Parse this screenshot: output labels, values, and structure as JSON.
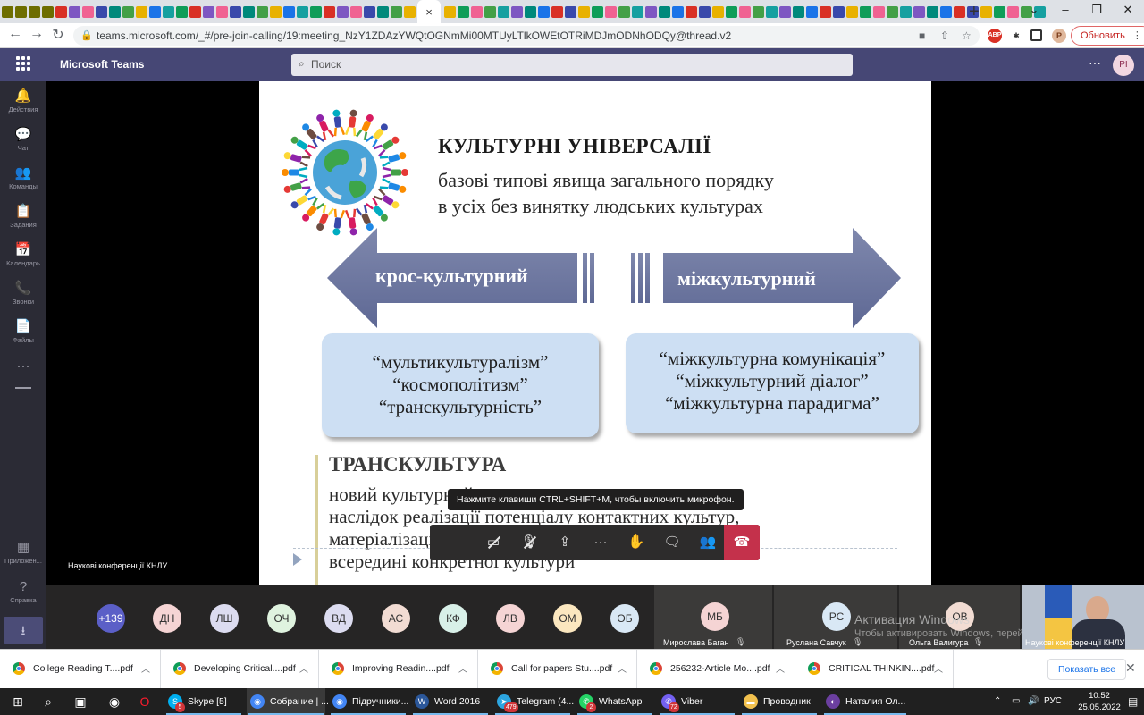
{
  "browser": {
    "active_tab_close": "×",
    "new_tab": "+",
    "window_controls": {
      "min": "⌄",
      "restore": "–",
      "max": "❐",
      "close": "✕"
    },
    "url": "teams.microsoft.com/_#/pre-join-calling/19:meeting_NzY1ZDAzYWQtOGNmMi00MTUyLTlkOWEtOTRiMDJmODNhODQy@thread.v2",
    "update_button": "Обновить",
    "profile_initial": "Р"
  },
  "teams": {
    "app_title": "Microsoft Teams",
    "search_placeholder": "Поиск",
    "more": "···",
    "avatar_initials": "РІ",
    "rail": [
      {
        "label": "Действия",
        "icon": "bell-icon",
        "glyph": "🔔"
      },
      {
        "label": "Чат",
        "icon": "chat-icon",
        "glyph": "💬"
      },
      {
        "label": "Команды",
        "icon": "teams-icon",
        "glyph": "👥"
      },
      {
        "label": "Задания",
        "icon": "assignments-icon",
        "glyph": "📋"
      },
      {
        "label": "Календарь",
        "icon": "calendar-icon",
        "glyph": "📅"
      },
      {
        "label": "Звонки",
        "icon": "phone-icon",
        "glyph": "📞"
      },
      {
        "label": "Файлы",
        "icon": "files-icon",
        "glyph": "📄"
      },
      {
        "label": "",
        "icon": "more-icon",
        "glyph": "···"
      }
    ],
    "rail_bottom": [
      {
        "label": "Приложен...",
        "icon": "apps-icon",
        "glyph": "▦"
      },
      {
        "label": "Справка",
        "icon": "help-icon",
        "glyph": "?"
      }
    ],
    "download_icon": "⭳"
  },
  "slide": {
    "title": "КУЛЬТУРНІ УНІВЕРСАЛІЇ",
    "subtitle_line1": "базові типові явища загального порядку",
    "subtitle_line2": "в усіх без винятку людських культурах",
    "left_arrow": "крос-культурний",
    "right_arrow": "міжкультурний",
    "left_box": [
      "“мультикультуралізм”",
      "“космополітизм”",
      "“транскультурність”"
    ],
    "right_box": [
      "“міжкультурна комунікація”",
      "“міжкультурний діалог”",
      "“міжкультурна парадигма”"
    ],
    "section_title": "ТРАНСКУЛЬТУРА",
    "section_lines": [
      "новий культурний емерджент",
      "наслідок реалізації потенціалу контактних культур,",
      "матеріалізація яких була б неможлива",
      "всередині конкретної культури"
    ]
  },
  "meeting": {
    "presenter_label": "Наукові конференції КНЛУ",
    "mic_tooltip": "Нажмите клавиши CTRL+SHIFT+M, чтобы включить микрофон.",
    "controls": [
      {
        "name": "camera-off-button",
        "glyph": "▭",
        "slash": true
      },
      {
        "name": "mic-off-button",
        "glyph": "🎙",
        "slash": true
      },
      {
        "name": "share-screen-button",
        "glyph": "⇪",
        "slash": false
      },
      {
        "name": "more-actions-button",
        "glyph": "···",
        "slash": false
      },
      {
        "name": "raise-hand-button",
        "glyph": "✋",
        "slash": false
      },
      {
        "name": "chat-button",
        "glyph": "🗨",
        "slash": false
      },
      {
        "name": "participants-button",
        "glyph": "👥",
        "slash": false
      }
    ],
    "hangup_glyph": "☎",
    "overflow_count": "+139",
    "avatars": [
      {
        "initials": "ДН",
        "color": "#f5d4d4"
      },
      {
        "initials": "ЛШ",
        "color": "#dcdcf0"
      },
      {
        "initials": "ОЧ",
        "color": "#dff3df"
      },
      {
        "initials": "ВД",
        "color": "#dcdcf0"
      },
      {
        "initials": "АС",
        "color": "#f2dcd3"
      },
      {
        "initials": "КФ",
        "color": "#d8f0e8"
      },
      {
        "initials": "ЛВ",
        "color": "#f5d4d4"
      },
      {
        "initials": "ОМ",
        "color": "#fbe7bf"
      },
      {
        "initials": "ОБ",
        "color": "#d9e8f5"
      }
    ],
    "tiles": [
      {
        "initials": "МБ",
        "color": "#f5d4d4",
        "name": "Мирослава Баган"
      },
      {
        "initials": "РС",
        "color": "#d9e8f5",
        "name": "Руслана Савчук"
      },
      {
        "initials": "ОВ",
        "color": "#f2dcd3",
        "name": "Ольга Валигура"
      }
    ],
    "camera_tile_name": "Наукові конференції КНЛУ",
    "windows_activation_title": "Активация Windows",
    "windows_activation_text": "Чтобы активировать Windows, перейдите в раздел «Параметры»."
  },
  "downloads": {
    "items": [
      "College Reading T....pdf",
      "Developing Critical....pdf",
      "Improving Readin....pdf",
      "Call for papers Stu....pdf",
      "256232-Article Mo....pdf",
      "CRITICAL THINKIN....pdf"
    ],
    "show_all": "Показать все",
    "close": "✕"
  },
  "taskbar": {
    "apps": [
      {
        "label": "Skype [5]",
        "color": "#00aff0",
        "glyph": "S",
        "badge": "5"
      },
      {
        "label": "Собрание | ...",
        "color": "#4285f4",
        "glyph": "◉",
        "badge": ""
      },
      {
        "label": "Підручники...",
        "color": "#4285f4",
        "glyph": "◉",
        "badge": ""
      },
      {
        "label": "Word 2016",
        "color": "#2b579a",
        "glyph": "W",
        "badge": ""
      },
      {
        "label": "Telegram (4...",
        "color": "#2ca5e0",
        "glyph": "➤",
        "badge": "479"
      },
      {
        "label": "WhatsApp",
        "color": "#25d366",
        "glyph": "✆",
        "badge": "2"
      },
      {
        "label": "Viber",
        "color": "#7360f2",
        "glyph": "✆",
        "badge": "72"
      },
      {
        "label": "Проводник",
        "color": "#f2c14e",
        "glyph": "▬",
        "badge": ""
      },
      {
        "label": "Наталия Ол...",
        "color": "#6b3fa0",
        "glyph": "◐",
        "badge": ""
      }
    ],
    "lang": "РУС",
    "time": "10:52",
    "date": "25.05.2022"
  }
}
